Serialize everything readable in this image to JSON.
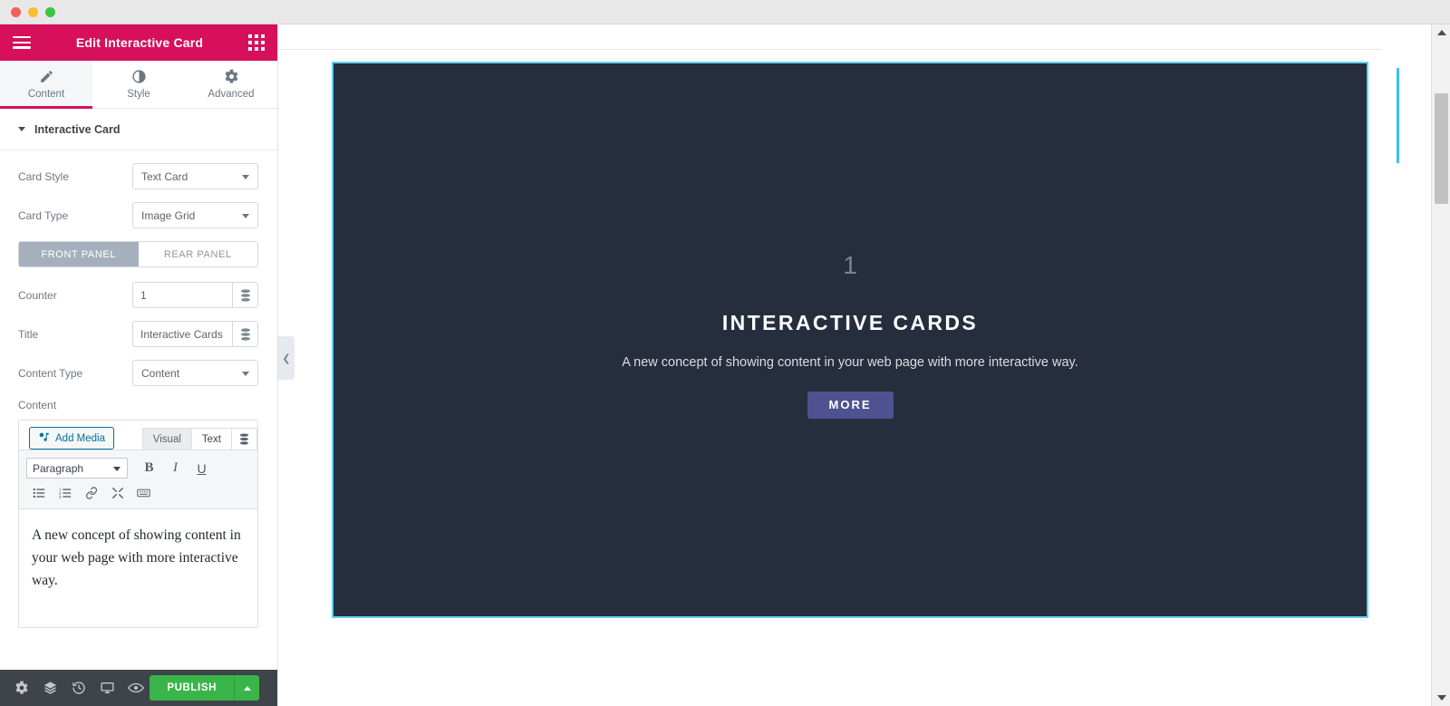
{
  "window": {
    "traffic_lights": [
      "close",
      "minimize",
      "maximize"
    ]
  },
  "panel": {
    "header": {
      "title": "Edit Interactive Card",
      "menu_icon": "hamburger-icon",
      "apps_icon": "grid-apps-icon",
      "background_color": "#d6105a"
    },
    "tabs": [
      {
        "label": "Content",
        "icon": "pencil-icon",
        "active": true
      },
      {
        "label": "Style",
        "icon": "contrast-half-circle-icon",
        "active": false
      },
      {
        "label": "Advanced",
        "icon": "gear-icon",
        "active": false
      }
    ],
    "section": {
      "title": "Interactive Card",
      "collapsed": false
    },
    "controls": {
      "card_style": {
        "label": "Card Style",
        "value": "Text Card"
      },
      "card_type": {
        "label": "Card Type",
        "value": "Image Grid"
      },
      "panel_toggle": {
        "options": [
          "FRONT PANEL",
          "REAR PANEL"
        ],
        "selected": "FRONT PANEL"
      },
      "counter": {
        "label": "Counter",
        "value": "1",
        "dynamic_icon": "dynamic-tags-icon"
      },
      "title": {
        "label": "Title",
        "value": "Interactive Cards",
        "dynamic_icon": "dynamic-tags-icon"
      },
      "content_type": {
        "label": "Content Type",
        "value": "Content"
      },
      "content": {
        "label": "Content"
      }
    },
    "editor": {
      "add_media_label": "Add Media",
      "add_media_icon": "media-icon",
      "tabs": [
        {
          "label": "Visual",
          "active": false
        },
        {
          "label": "Text",
          "active": true
        }
      ],
      "dynamic_icon": "dynamic-tags-icon",
      "format_select": "Paragraph",
      "toolbar_row1": [
        {
          "name": "bold-button",
          "glyph": "B"
        },
        {
          "name": "italic-button",
          "glyph": "I"
        },
        {
          "name": "underline-button",
          "glyph": "U"
        }
      ],
      "toolbar_row2": [
        {
          "name": "bullet-list-button",
          "glyph": "bullet-list-icon"
        },
        {
          "name": "numbered-list-button",
          "glyph": "numbered-list-icon"
        },
        {
          "name": "insert-link-button",
          "glyph": "link-icon"
        },
        {
          "name": "insert-more-button",
          "glyph": "more-tag-icon"
        },
        {
          "name": "keyboard-shortcuts-button",
          "glyph": "keyboard-icon"
        }
      ],
      "body_text": "A new concept of showing content in your web page with more interactive way."
    },
    "footer": {
      "icons": [
        {
          "name": "settings-gear-icon"
        },
        {
          "name": "navigator-layers-icon"
        },
        {
          "name": "history-revisions-icon"
        },
        {
          "name": "responsive-monitor-icon"
        },
        {
          "name": "preview-eye-icon"
        }
      ],
      "publish_label": "PUBLISH",
      "publish_color": "#39b54a",
      "publish_arrow_icon": "chevron-up-icon"
    },
    "collapse_handle_icon": "chevron-left-icon"
  },
  "preview": {
    "card": {
      "counter": "1",
      "title": "INTERACTIVE CARDS",
      "description": "A new concept of showing content in your web page with more interactive way.",
      "button_label": "MORE",
      "background_color": "#262e3e",
      "selection_border_color": "#5ed2f3",
      "button_color": "#4e5291"
    }
  },
  "scrollbar": {
    "up_arrow_icon": "scroll-up-arrow-icon",
    "down_arrow_icon": "scroll-down-arrow-icon",
    "thumb": "scrollbar-thumb",
    "accent_color": "#35c3f3"
  }
}
